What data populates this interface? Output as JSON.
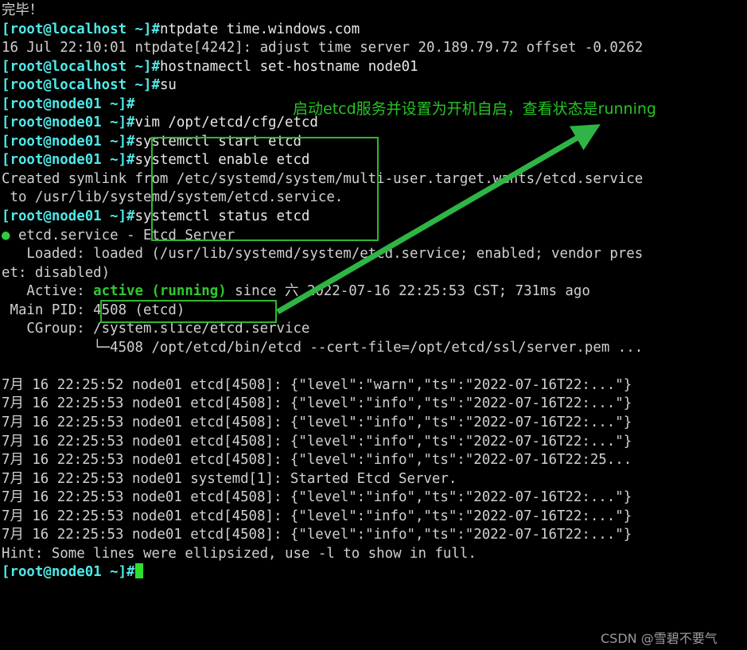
{
  "terminal": {
    "lines": [
      {
        "type": "plain_cjk",
        "text": "完毕！"
      },
      {
        "type": "prompt_cmd",
        "prompt": "[root@localhost ~]#",
        "cmd": "ntpdate time.windows.com"
      },
      {
        "type": "plain",
        "text": "16 Jul 22:10:01 ntpdate[4242]: adjust time server 20.189.79.72 offset -0.0262"
      },
      {
        "type": "prompt_cmd",
        "prompt": "[root@localhost ~]#",
        "cmd": "hostnamectl set-hostname node01"
      },
      {
        "type": "prompt_cmd",
        "prompt": "[root@localhost ~]#",
        "cmd": "su"
      },
      {
        "type": "prompt_cmd",
        "prompt": "[root@node01 ~]#",
        "cmd": ""
      },
      {
        "type": "prompt_cmd",
        "prompt": "[root@node01 ~]#",
        "cmd": "vim /opt/etcd/cfg/etcd"
      },
      {
        "type": "prompt_cmd",
        "prompt": "[root@node01 ~]#",
        "cmd": "systemctl start etcd"
      },
      {
        "type": "prompt_cmd",
        "prompt": "[root@node01 ~]#",
        "cmd": "systemctl enable etcd"
      },
      {
        "type": "plain",
        "text": "Created symlink from /etc/systemd/system/multi-user.target.wants/etcd.service"
      },
      {
        "type": "plain",
        "text": " to /usr/lib/systemd/system/etcd.service."
      },
      {
        "type": "prompt_cmd",
        "prompt": "[root@node01 ~]#",
        "cmd": "systemctl status etcd"
      },
      {
        "type": "service_header",
        "dot": "●",
        "text": " etcd.service - Etcd Server"
      },
      {
        "type": "plain",
        "text": "   Loaded: loaded (/usr/lib/systemd/system/etcd.service; enabled; vendor pres"
      },
      {
        "type": "plain",
        "text": "et: disabled)"
      },
      {
        "type": "active_line",
        "before": "   Active: ",
        "status": "active (running)",
        "after": " since 六 2022-07-16 22:25:53 CST; 731ms ago"
      },
      {
        "type": "plain",
        "text": " Main PID: 4508 (etcd)"
      },
      {
        "type": "plain",
        "text": "   CGroup: /system.slice/etcd.service"
      },
      {
        "type": "plain",
        "text": "           └─4508 /opt/etcd/bin/etcd --cert-file=/opt/etcd/ssl/server.pem ..."
      },
      {
        "type": "plain",
        "text": ""
      },
      {
        "type": "plain",
        "text": "7月 16 22:25:52 node01 etcd[4508]: {\"level\":\"warn\",\"ts\":\"2022-07-16T22:...\"}"
      },
      {
        "type": "plain",
        "text": "7月 16 22:25:53 node01 etcd[4508]: {\"level\":\"info\",\"ts\":\"2022-07-16T22:...\"}"
      },
      {
        "type": "plain",
        "text": "7月 16 22:25:53 node01 etcd[4508]: {\"level\":\"info\",\"ts\":\"2022-07-16T22:...\"}"
      },
      {
        "type": "plain",
        "text": "7月 16 22:25:53 node01 etcd[4508]: {\"level\":\"info\",\"ts\":\"2022-07-16T22:...\"}"
      },
      {
        "type": "plain",
        "text": "7月 16 22:25:53 node01 etcd[4508]: {\"level\":\"info\",\"ts\":\"2022-07-16T22:25..."
      },
      {
        "type": "plain",
        "text": "7月 16 22:25:53 node01 systemd[1]: Started Etcd Server."
      },
      {
        "type": "plain",
        "text": "7月 16 22:25:53 node01 etcd[4508]: {\"level\":\"info\",\"ts\":\"2022-07-16T22:...\"}"
      },
      {
        "type": "plain",
        "text": "7月 16 22:25:53 node01 etcd[4508]: {\"level\":\"info\",\"ts\":\"2022-07-16T22:...\"}"
      },
      {
        "type": "plain",
        "text": "7月 16 22:25:53 node01 etcd[4508]: {\"level\":\"info\",\"ts\":\"2022-07-16T22:...\"}"
      },
      {
        "type": "plain",
        "text": "Hint: Some lines were ellipsized, use -l to show in full."
      },
      {
        "type": "prompt_cursor",
        "prompt": "[root@node01 ~]#"
      }
    ]
  },
  "annotations": {
    "note": "启动etcd服务并设置为开机自启，查看状态是running",
    "note_color": "#26c426",
    "box_color": "#2eb82e",
    "arrow_color": "#2eb545"
  },
  "watermark": {
    "text": "CSDN @雪碧不要气"
  }
}
